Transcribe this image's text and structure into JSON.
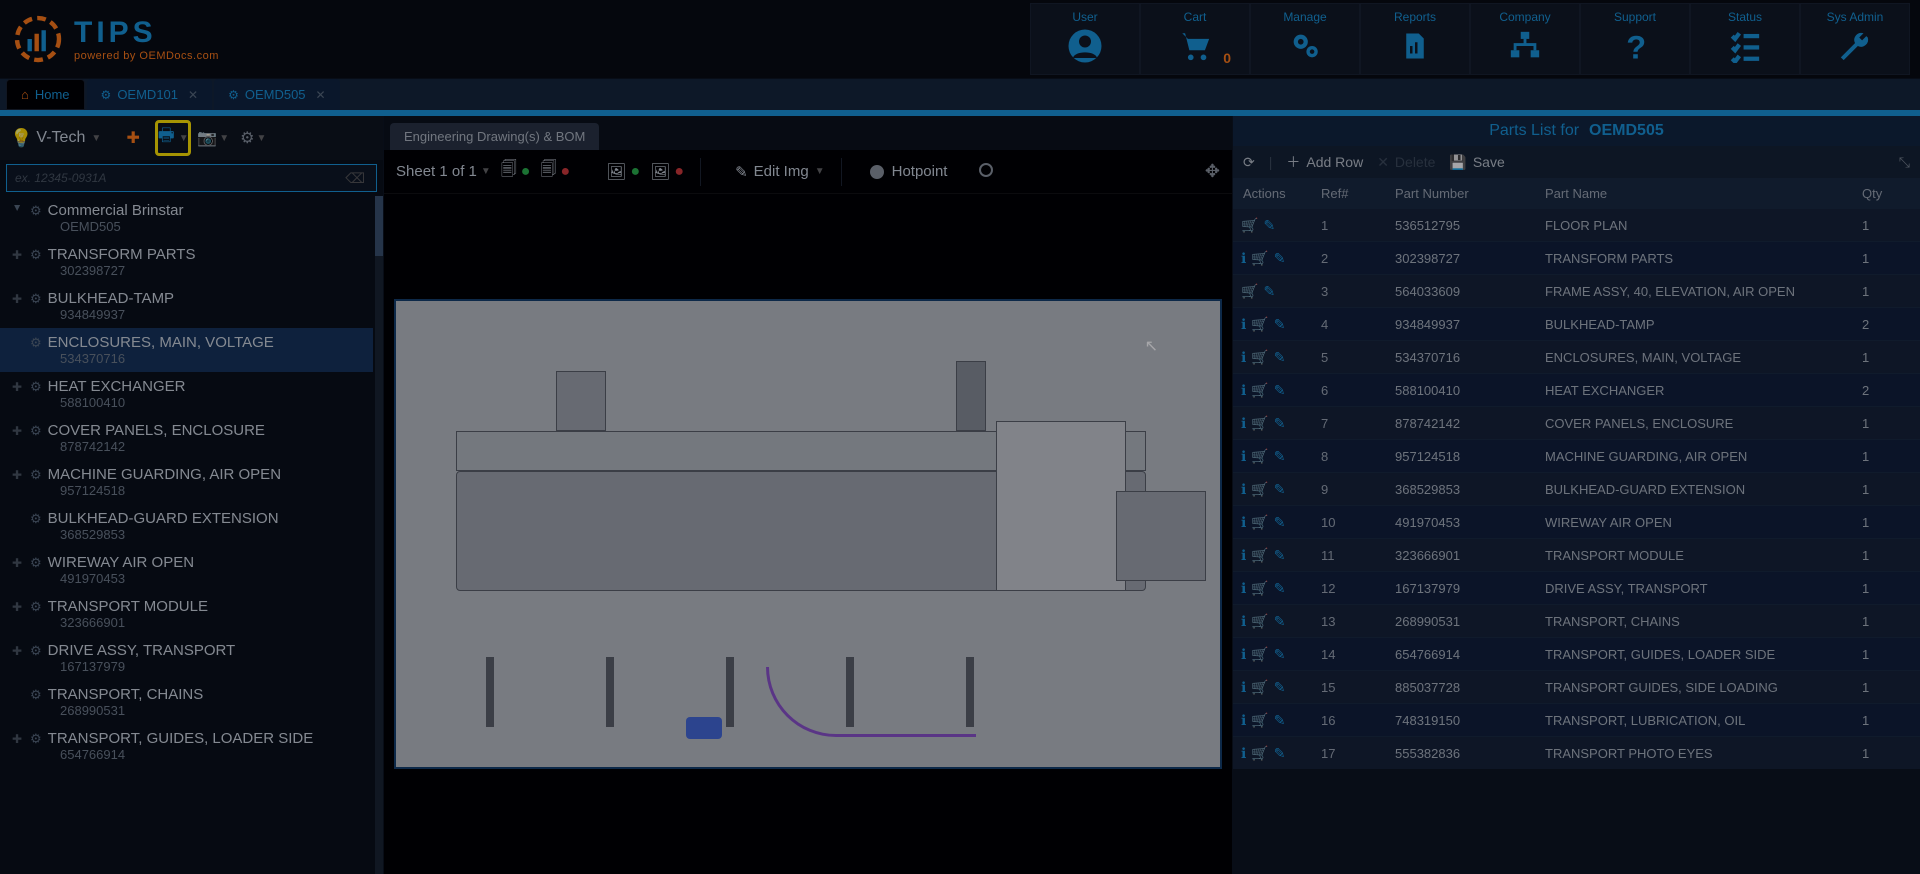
{
  "brand": {
    "title": "TIPS",
    "subtitle": "powered by OEMDocs.com"
  },
  "topnav": [
    {
      "label": "User",
      "icon": "user-circle"
    },
    {
      "label": "Cart",
      "icon": "cart",
      "badge": "0"
    },
    {
      "label": "Manage",
      "icon": "gears"
    },
    {
      "label": "Reports",
      "icon": "report"
    },
    {
      "label": "Company",
      "icon": "org"
    },
    {
      "label": "Support",
      "icon": "question"
    },
    {
      "label": "Status",
      "icon": "checklist"
    },
    {
      "label": "Sys Admin",
      "icon": "wrench"
    }
  ],
  "tabs": {
    "home": "Home",
    "items": [
      {
        "label": "OEMD101"
      },
      {
        "label": "OEMD505"
      }
    ]
  },
  "leftToolbar": {
    "org": "V-Tech"
  },
  "search": {
    "placeholder": "ex. 12345-0931A"
  },
  "tree": [
    {
      "name": "Commercial Brinstar",
      "code": "OEMD505",
      "root": true
    },
    {
      "name": "TRANSFORM PARTS",
      "code": "302398727"
    },
    {
      "name": "BULKHEAD-TAMP",
      "code": "934849937"
    },
    {
      "name": "ENCLOSURES, MAIN, VOLTAGE",
      "code": "534370716",
      "noexpand": true,
      "active": true
    },
    {
      "name": "HEAT EXCHANGER",
      "code": "588100410"
    },
    {
      "name": "COVER PANELS, ENCLOSURE",
      "code": "878742142"
    },
    {
      "name": "MACHINE GUARDING, AIR OPEN",
      "code": "957124518"
    },
    {
      "name": "BULKHEAD-GUARD EXTENSION",
      "code": "368529853",
      "noexpand": true
    },
    {
      "name": "WIREWAY AIR OPEN",
      "code": "491970453"
    },
    {
      "name": "TRANSPORT MODULE",
      "code": "323666901"
    },
    {
      "name": "DRIVE ASSY, TRANSPORT",
      "code": "167137979"
    },
    {
      "name": "TRANSPORT, CHAINS",
      "code": "268990531",
      "noexpand": true
    },
    {
      "name": "TRANSPORT, GUIDES, LOADER SIDE",
      "code": "654766914"
    }
  ],
  "center": {
    "tabLabel": "Engineering Drawing(s) & BOM",
    "sheetLabel": "Sheet 1 of 1",
    "editImg": "Edit Img",
    "hotpoint": "Hotpoint"
  },
  "partsList": {
    "title": "Parts List for",
    "id": "OEMD505",
    "addRow": "Add Row",
    "delete": "Delete",
    "save": "Save",
    "columns": {
      "actions": "Actions",
      "ref": "Ref#",
      "pn": "Part Number",
      "name": "Part Name",
      "qty": "Qty"
    },
    "rows": [
      {
        "ref": "1",
        "pn": "536512795",
        "name": "FLOOR PLAN",
        "qty": "1",
        "info": false
      },
      {
        "ref": "2",
        "pn": "302398727",
        "name": "TRANSFORM PARTS",
        "qty": "1",
        "info": true
      },
      {
        "ref": "3",
        "pn": "564033609",
        "name": "FRAME ASSY, 40, ELEVATION, AIR OPEN",
        "qty": "1",
        "info": false
      },
      {
        "ref": "4",
        "pn": "934849937",
        "name": "BULKHEAD-TAMP",
        "qty": "2",
        "info": true
      },
      {
        "ref": "5",
        "pn": "534370716",
        "name": "ENCLOSURES, MAIN, VOLTAGE",
        "qty": "1",
        "info": true
      },
      {
        "ref": "6",
        "pn": "588100410",
        "name": "HEAT EXCHANGER",
        "qty": "2",
        "info": true
      },
      {
        "ref": "7",
        "pn": "878742142",
        "name": "COVER PANELS, ENCLOSURE",
        "qty": "1",
        "info": true
      },
      {
        "ref": "8",
        "pn": "957124518",
        "name": "MACHINE GUARDING, AIR OPEN",
        "qty": "1",
        "info": true
      },
      {
        "ref": "9",
        "pn": "368529853",
        "name": "BULKHEAD-GUARD EXTENSION",
        "qty": "1",
        "info": true
      },
      {
        "ref": "10",
        "pn": "491970453",
        "name": "WIREWAY AIR OPEN",
        "qty": "1",
        "info": true
      },
      {
        "ref": "11",
        "pn": "323666901",
        "name": "TRANSPORT MODULE",
        "qty": "1",
        "info": true
      },
      {
        "ref": "12",
        "pn": "167137979",
        "name": "DRIVE ASSY, TRANSPORT",
        "qty": "1",
        "info": true
      },
      {
        "ref": "13",
        "pn": "268990531",
        "name": "TRANSPORT, CHAINS",
        "qty": "1",
        "info": true
      },
      {
        "ref": "14",
        "pn": "654766914",
        "name": "TRANSPORT, GUIDES, LOADER SIDE",
        "qty": "1",
        "info": true
      },
      {
        "ref": "15",
        "pn": "885037728",
        "name": "TRANSPORT GUIDES, SIDE LOADING",
        "qty": "1",
        "info": true
      },
      {
        "ref": "16",
        "pn": "748319150",
        "name": "TRANSPORT, LUBRICATION, OIL",
        "qty": "1",
        "info": true
      },
      {
        "ref": "17",
        "pn": "555382836",
        "name": "TRANSPORT PHOTO EYES",
        "qty": "1",
        "info": true
      }
    ]
  }
}
